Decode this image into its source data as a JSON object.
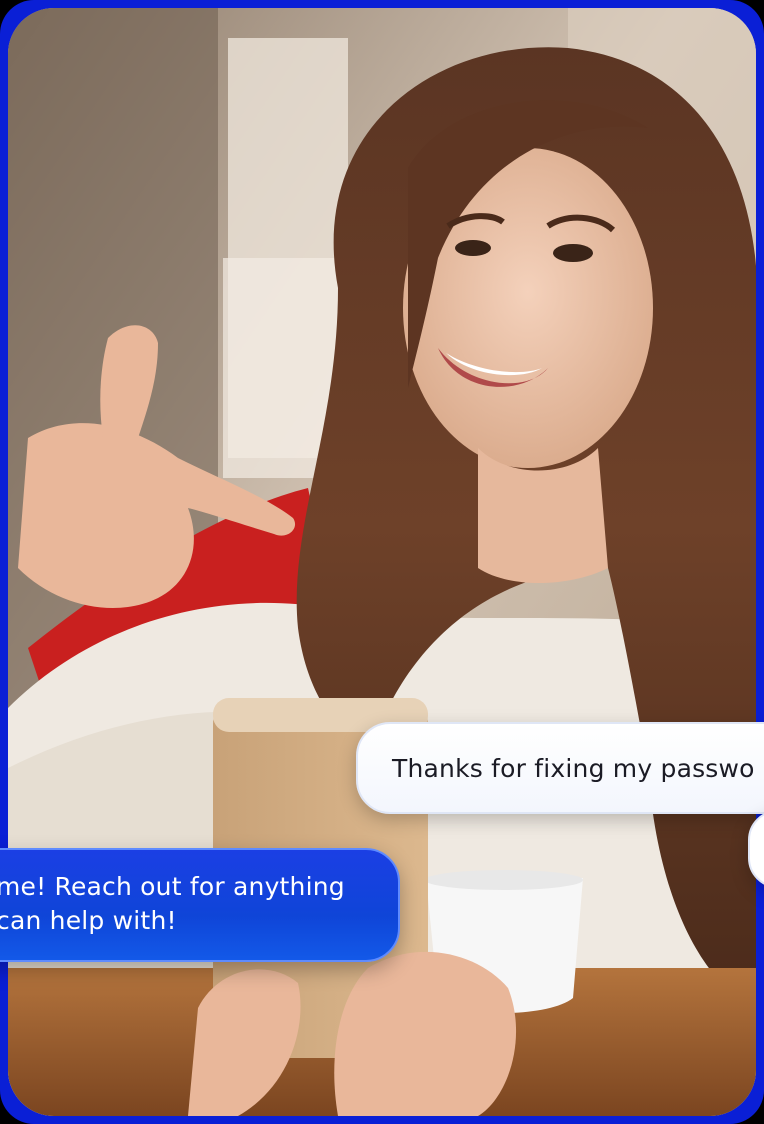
{
  "chat": {
    "user_message": "Thanks for fixing my passwo",
    "agent_message_line1": "me! Reach out for anything",
    "agent_message_line2": "can help with!"
  },
  "colors": {
    "frame_border": "#0a1fd6",
    "agent_bubble": "#1248dc",
    "user_bubble": "#f7f9ff",
    "user_text": "#1b1b25",
    "agent_text": "#ffffff"
  }
}
